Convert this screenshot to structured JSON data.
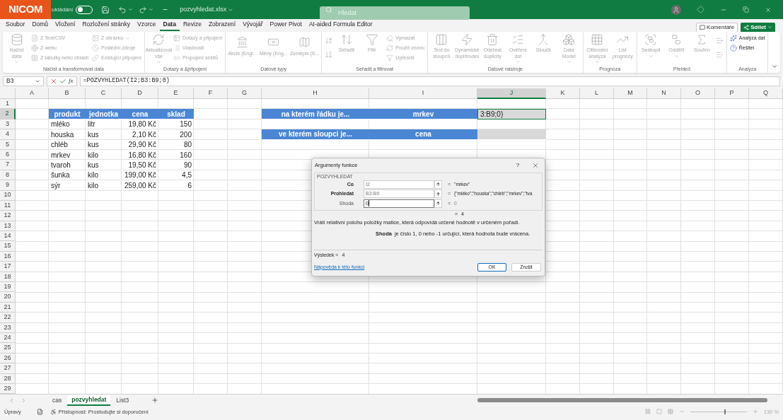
{
  "title_bar": {
    "logo": "NICOM",
    "autosave_label": "ukládání",
    "autosave_on": false,
    "filename": "pozvyhledat.xlsx",
    "search_placeholder": "Hledat"
  },
  "menu": {
    "tabs": [
      {
        "label": "Soubor",
        "selected": false
      },
      {
        "label": "Domů",
        "selected": false
      },
      {
        "label": "Vložení",
        "selected": false
      },
      {
        "label": "Rozložení stránky",
        "selected": false
      },
      {
        "label": "Vzorce",
        "selected": false
      },
      {
        "label": "Data",
        "selected": true
      },
      {
        "label": "Revize",
        "selected": false
      },
      {
        "label": "Zobrazení",
        "selected": false
      },
      {
        "label": "Vývojář",
        "selected": false
      },
      {
        "label": "Power Pivot",
        "selected": false
      },
      {
        "label": "AI-aided Formula Editor",
        "selected": false
      }
    ],
    "comments": "Komentáře",
    "share": "Sdílet"
  },
  "ribbon": {
    "groups": [
      {
        "label": "Načíst a transformovat data",
        "columns": [
          [
            {
              "kind": "large",
              "text": "Načíst data",
              "menu": true,
              "disabled": true
            }
          ],
          [
            {
              "kind": "small",
              "text": "Z Text/CSV",
              "menu": false,
              "disabled": true
            },
            {
              "kind": "small",
              "text": "Z webu",
              "menu": false,
              "disabled": true
            },
            {
              "kind": "small",
              "text": "Z tabulky nebo oblasti",
              "menu": false,
              "disabled": true
            }
          ],
          [
            {
              "kind": "small",
              "text": "Z obrázku",
              "menu": true,
              "disabled": true
            },
            {
              "kind": "small",
              "text": "Poslední zdroje",
              "menu": false,
              "disabled": true
            },
            {
              "kind": "small",
              "text": "Existující připojení",
              "menu": false,
              "disabled": true
            }
          ]
        ]
      },
      {
        "label": "Dotazy a &připojení",
        "columns": [
          [
            {
              "kind": "large",
              "text": "Aktualizovat vše",
              "menu": true,
              "disabled": true
            }
          ],
          [
            {
              "kind": "small",
              "text": "Dotazy a připojení",
              "menu": false,
              "disabled": true
            },
            {
              "kind": "small",
              "text": "Vlastnosti",
              "menu": false,
              "disabled": true
            },
            {
              "kind": "small",
              "text": "Propojení sešitů",
              "menu": false,
              "disabled": true
            }
          ]
        ]
      },
      {
        "label": "Datové typy",
        "columns": [
          [
            {
              "kind": "gallery",
              "text": "Akcie (Engl...",
              "menu": false,
              "disabled": true
            }
          ],
          [
            {
              "kind": "gallery",
              "text": "Měny (Eng...",
              "menu": false,
              "disabled": true
            }
          ],
          [
            {
              "kind": "gallery",
              "text": "Zeměpis (E...",
              "menu": false,
              "disabled": true
            }
          ]
        ]
      },
      {
        "label": "Seřadit a filtrovat",
        "columns": [
          [
            {
              "kind": "icon",
              "menu": false,
              "disabled": true
            },
            {
              "kind": "icon",
              "menu": false,
              "disabled": true
            }
          ],
          [
            {
              "kind": "large",
              "text": "Seřadit",
              "menu": false,
              "disabled": true
            }
          ],
          [
            {
              "kind": "large",
              "text": "Filtr",
              "menu": false,
              "disabled": true
            }
          ],
          [
            {
              "kind": "small",
              "text": "Vymazat",
              "menu": false,
              "disabled": true
            },
            {
              "kind": "small",
              "text": "Použít znovu",
              "menu": false,
              "disabled": true
            },
            {
              "kind": "small",
              "text": "Upřesnit",
              "menu": false,
              "disabled": true
            }
          ]
        ]
      },
      {
        "label": "Datové nástroje",
        "columns": [
          [
            {
              "kind": "large",
              "text": "Text do sloupců",
              "menu": false,
              "disabled": true
            }
          ],
          [
            {
              "kind": "large",
              "text": "Dynamické doplňování",
              "menu": false,
              "disabled": true
            }
          ],
          [
            {
              "kind": "large",
              "text": "Odebrat duplicity",
              "menu": false,
              "disabled": true
            }
          ],
          [
            {
              "kind": "large",
              "text": "Ověření dat",
              "menu": true,
              "disabled": true
            }
          ],
          [
            {
              "kind": "large",
              "text": "Sloučit",
              "menu": false,
              "disabled": true
            }
          ],
          [
            {
              "kind": "large",
              "text": "Data Model",
              "menu": true,
              "disabled": true
            }
          ]
        ]
      },
      {
        "label": "Prognóza",
        "columns": [
          [
            {
              "kind": "large",
              "text": "Citlivostní analýza",
              "menu": true,
              "disabled": true
            }
          ],
          [
            {
              "kind": "large",
              "text": "List prognózy",
              "menu": false,
              "disabled": true
            }
          ]
        ]
      },
      {
        "label": "Přehled",
        "columns": [
          [
            {
              "kind": "large",
              "text": "Seskupit",
              "menu": true,
              "disabled": true
            }
          ],
          [
            {
              "kind": "large",
              "text": "Oddělit",
              "menu": true,
              "disabled": true
            }
          ],
          [
            {
              "kind": "large",
              "text": "Souhrn",
              "menu": false,
              "disabled": true
            }
          ],
          [
            {
              "kind": "icon",
              "menu": false,
              "disabled": true
            },
            {
              "kind": "icon",
              "menu": false,
              "disabled": true
            }
          ]
        ]
      },
      {
        "label": "Analýza",
        "columns": [
          [
            {
              "kind": "small",
              "text": "Analýza dat",
              "menu": false,
              "disabled": false
            },
            {
              "kind": "small",
              "text": "Řešitel",
              "menu": false,
              "disabled": false
            }
          ]
        ]
      }
    ]
  },
  "formula_bar": {
    "name_box": "B3",
    "function_label": "fx",
    "formula": "=POZVYHLEDAT(I2;B3:B9;0)"
  },
  "sheet": {
    "columns": [
      {
        "letter": "A",
        "selected": false
      },
      {
        "letter": "B",
        "selected": false
      },
      {
        "letter": "C",
        "selected": false
      },
      {
        "letter": "D",
        "selected": false
      },
      {
        "letter": "E",
        "selected": false
      },
      {
        "letter": "F",
        "selected": false
      },
      {
        "letter": "G",
        "selected": false
      },
      {
        "letter": "H",
        "selected": false
      },
      {
        "letter": "I",
        "selected": false
      },
      {
        "letter": "J",
        "selected": true
      },
      {
        "letter": "K",
        "selected": false
      },
      {
        "letter": "L",
        "selected": false
      },
      {
        "letter": "M",
        "selected": false
      },
      {
        "letter": "N",
        "selected": false
      },
      {
        "letter": "O",
        "selected": false
      },
      {
        "letter": "P",
        "selected": false
      },
      {
        "letter": "Q",
        "selected": false
      }
    ],
    "rows": [
      {
        "number": "1",
        "selected": false,
        "cells": []
      },
      {
        "number": "2",
        "selected": true,
        "cells": [
          {
            "kind": "empty"
          },
          {
            "kind": "header",
            "text": "produkt"
          },
          {
            "kind": "header",
            "text": "jednotka"
          },
          {
            "kind": "header",
            "text": "cena"
          },
          {
            "kind": "header",
            "text": "sklad"
          },
          {
            "kind": "empty"
          },
          {
            "kind": "empty"
          },
          {
            "kind": "header",
            "text": "na kterém řádku je..."
          },
          {
            "kind": "header",
            "text": "mrkev"
          },
          {
            "kind": "editing",
            "text": "3:B9;0)"
          }
        ]
      },
      {
        "number": "3",
        "selected": false,
        "cells": [
          {
            "kind": "empty"
          },
          {
            "kind": "text",
            "text": "mléko"
          },
          {
            "kind": "text",
            "text": "litr"
          },
          {
            "kind": "number",
            "text": "19,80 Kč"
          },
          {
            "kind": "number",
            "text": "150"
          }
        ]
      },
      {
        "number": "4",
        "selected": false,
        "cells": [
          {
            "kind": "empty"
          },
          {
            "kind": "text",
            "text": "houska"
          },
          {
            "kind": "text",
            "text": "kus"
          },
          {
            "kind": "number",
            "text": "2,10 Kč"
          },
          {
            "kind": "number",
            "text": "200"
          },
          {
            "kind": "empty"
          },
          {
            "kind": "empty"
          },
          {
            "kind": "header",
            "text": "ve kterém sloupci je..."
          },
          {
            "kind": "header",
            "text": "cena"
          },
          {
            "kind": "shaded"
          }
        ]
      },
      {
        "number": "5",
        "selected": false,
        "cells": [
          {
            "kind": "empty"
          },
          {
            "kind": "text",
            "text": "chléb"
          },
          {
            "kind": "text",
            "text": "kus"
          },
          {
            "kind": "number",
            "text": "29,90 Kč"
          },
          {
            "kind": "number",
            "text": "80"
          }
        ]
      },
      {
        "number": "6",
        "selected": false,
        "cells": [
          {
            "kind": "empty"
          },
          {
            "kind": "text",
            "text": "mrkev"
          },
          {
            "kind": "text",
            "text": "kilo"
          },
          {
            "kind": "number",
            "text": "16,80 Kč"
          },
          {
            "kind": "number",
            "text": "160"
          }
        ]
      },
      {
        "number": "7",
        "selected": false,
        "cells": [
          {
            "kind": "empty"
          },
          {
            "kind": "text",
            "text": "tvaroh"
          },
          {
            "kind": "text",
            "text": "kus"
          },
          {
            "kind": "number",
            "text": "19,50 Kč"
          },
          {
            "kind": "number",
            "text": "90"
          }
        ]
      },
      {
        "number": "8",
        "selected": false,
        "cells": [
          {
            "kind": "empty"
          },
          {
            "kind": "text",
            "text": "šunka"
          },
          {
            "kind": "text",
            "text": "kilo"
          },
          {
            "kind": "number",
            "text": "199,00 Kč"
          },
          {
            "kind": "number",
            "text": "4,5"
          }
        ]
      },
      {
        "number": "9",
        "selected": false,
        "cells": [
          {
            "kind": "empty"
          },
          {
            "kind": "text",
            "text": "sýr"
          },
          {
            "kind": "text",
            "text": "kilo"
          },
          {
            "kind": "number",
            "text": "259,00 Kč"
          },
          {
            "kind": "number",
            "text": "6"
          }
        ]
      },
      {
        "number": "10",
        "selected": false,
        "cells": []
      },
      {
        "number": "11",
        "selected": false,
        "cells": []
      },
      {
        "number": "12",
        "selected": false,
        "cells": []
      },
      {
        "number": "13",
        "selected": false,
        "cells": []
      },
      {
        "number": "14",
        "selected": false,
        "cells": []
      },
      {
        "number": "15",
        "selected": false,
        "cells": []
      },
      {
        "number": "16",
        "selected": false,
        "cells": []
      },
      {
        "number": "17",
        "selected": false,
        "cells": []
      },
      {
        "number": "18",
        "selected": false,
        "cells": []
      },
      {
        "number": "19",
        "selected": false,
        "cells": []
      },
      {
        "number": "20",
        "selected": false,
        "cells": []
      },
      {
        "number": "21",
        "selected": false,
        "cells": []
      },
      {
        "number": "22",
        "selected": false,
        "cells": []
      },
      {
        "number": "23",
        "selected": false,
        "cells": []
      },
      {
        "number": "24",
        "selected": false,
        "cells": []
      },
      {
        "number": "25",
        "selected": false,
        "cells": []
      },
      {
        "number": "26",
        "selected": false,
        "cells": []
      },
      {
        "number": "27",
        "selected": false,
        "cells": []
      },
      {
        "number": "28",
        "selected": false,
        "cells": []
      },
      {
        "number": "29",
        "selected": false,
        "cells": []
      }
    ]
  },
  "dialog": {
    "title": "Argumenty funkce",
    "help": "?",
    "function_name": "POZVYHLEDAT",
    "args": [
      {
        "label": "Co",
        "required": true,
        "value": "I2",
        "focused": false,
        "equals": "=",
        "result": "\"mrkev\""
      },
      {
        "label": "Prohledat",
        "required": true,
        "value": "B3:B9",
        "focused": false,
        "equals": "=",
        "result": "{\"mléko\";\"houska\";\"chléb\";\"mrkev\";\"tva"
      },
      {
        "label": "Shoda",
        "required": false,
        "value": "0",
        "focused": true,
        "equals": "=",
        "result": "0"
      }
    ],
    "formula_equals": "=",
    "formula_value": "4",
    "description": "Vrátí relativní polohu položky matice, která odpovídá určené hodnotě v určeném pořadí.",
    "arg_help_name": "Shoda",
    "arg_help_text": "je číslo 1, 0 nebo -1 určující, která hodnota bude vrácena.",
    "result_label": "Výsledek =",
    "result_value": "4",
    "help_link": "Nápověda k této funkci",
    "ok": "OK",
    "cancel": "Zrušit"
  },
  "sheet_tabs": [
    {
      "label": "cas",
      "selected": false
    },
    {
      "label": "pozvyhledat",
      "selected": true
    },
    {
      "label": "List3",
      "selected": false
    }
  ],
  "status_bar": {
    "mode": "Úpravy",
    "accessibility": "Přístupnost: Prostudujte si doporučení",
    "zoom": {
      "level": 0.6,
      "reading": "130 %"
    }
  }
}
